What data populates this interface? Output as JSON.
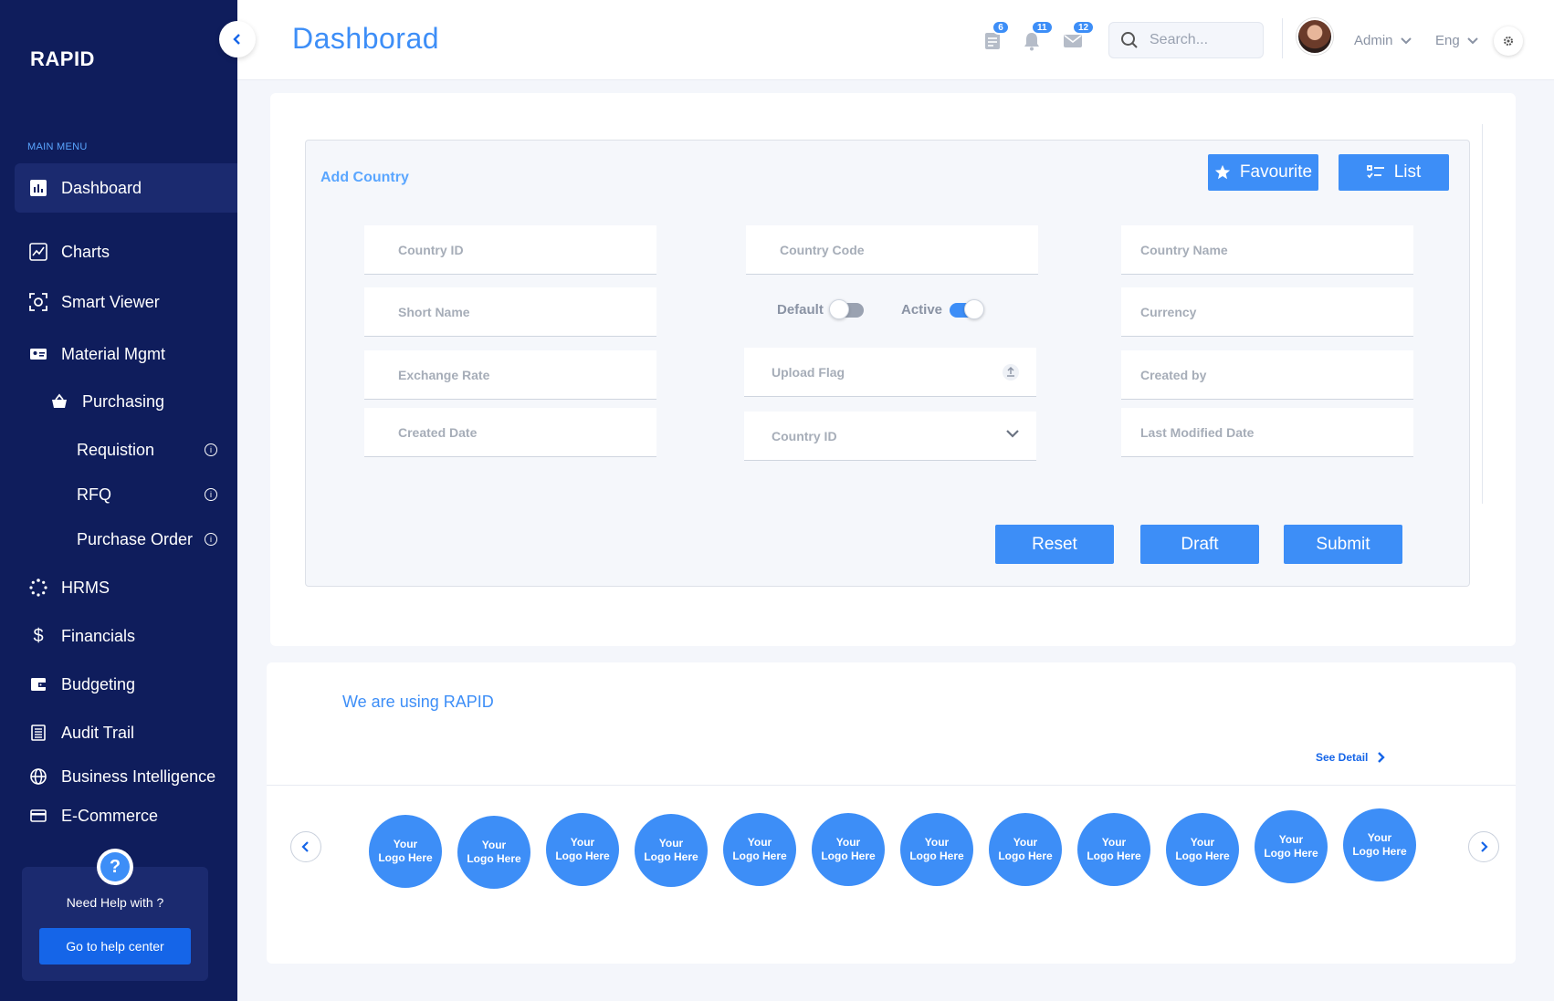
{
  "sidebar": {
    "brand": "RAPID",
    "menu_caption": "MAIN MENU",
    "items": [
      {
        "label": "Dashboard",
        "icon": "bar-chart-icon"
      },
      {
        "label": "Charts",
        "icon": "line-chart-icon"
      },
      {
        "label": "Smart Viewer",
        "icon": "scan-icon"
      },
      {
        "label": "Material Mgmt",
        "icon": "id-card-icon"
      },
      {
        "label": "Purchasing",
        "icon": "basket-icon"
      },
      {
        "label": "Requistion",
        "icon": "info-icon"
      },
      {
        "label": "RFQ",
        "icon": "info-icon"
      },
      {
        "label": "Purchase Order",
        "icon": "info-icon"
      },
      {
        "label": "HRMS",
        "icon": "spinner-icon"
      },
      {
        "label": "Financials",
        "icon": "dollar-icon"
      },
      {
        "label": "Budgeting",
        "icon": "wallet-icon"
      },
      {
        "label": "Audit Trail",
        "icon": "list-icon"
      },
      {
        "label": "Business Intelligence",
        "icon": "globe-icon"
      },
      {
        "label": "E-Commerce",
        "icon": "card-icon"
      }
    ],
    "help": {
      "icon": "?",
      "text": "Need Help with ?",
      "button": "Go to help center"
    }
  },
  "header": {
    "title": "Dashborad",
    "badges": {
      "documents": "6",
      "notifications": "11",
      "messages": "12"
    },
    "search_placeholder": "Search...",
    "user": "Admin",
    "language": "Eng"
  },
  "form": {
    "title": "Add Country",
    "favourite_label": "Favourite",
    "list_label": "List",
    "fields": {
      "country_id": "Country ID",
      "country_code": "Country Code",
      "country_name": "Country Name",
      "short_name": "Short Name",
      "currency": "Currency",
      "exchange_rate": "Exchange Rate",
      "upload_flag": "Upload Flag",
      "created_by": "Created by",
      "created_date": "Created Date",
      "country_id_select": "Country ID",
      "last_modified_date": "Last Modified Date"
    },
    "toggles": {
      "default_label": "Default",
      "default_on": false,
      "active_label": "Active",
      "active_on": true
    },
    "actions": {
      "reset": "Reset",
      "draft": "Draft",
      "submit": "Submit"
    }
  },
  "logos_section": {
    "title": "We are using RAPID",
    "see_detail": "See Detail",
    "logos": [
      {
        "line1": "Your",
        "line2": "Logo Here"
      },
      {
        "line1": "Your",
        "line2": "Logo Here"
      },
      {
        "line1": "Your",
        "line2": "Logo Here"
      },
      {
        "line1": "Your",
        "line2": "Logo Here"
      },
      {
        "line1": "Your",
        "line2": "Logo Here"
      },
      {
        "line1": "Your",
        "line2": "Logo Here"
      },
      {
        "line1": "Your",
        "line2": "Logo Here"
      },
      {
        "line1": "Your",
        "line2": "Logo Here"
      },
      {
        "line1": "Your",
        "line2": "Logo Here"
      },
      {
        "line1": "Your",
        "line2": "Logo Here"
      },
      {
        "line1": "Your",
        "line2": "Logo Here"
      },
      {
        "line1": "Your",
        "line2": "Logo Here"
      }
    ]
  },
  "colors": {
    "sidebar_bg": "#0f1d5c",
    "accent": "#3d8ef7",
    "link": "#1565e8"
  }
}
